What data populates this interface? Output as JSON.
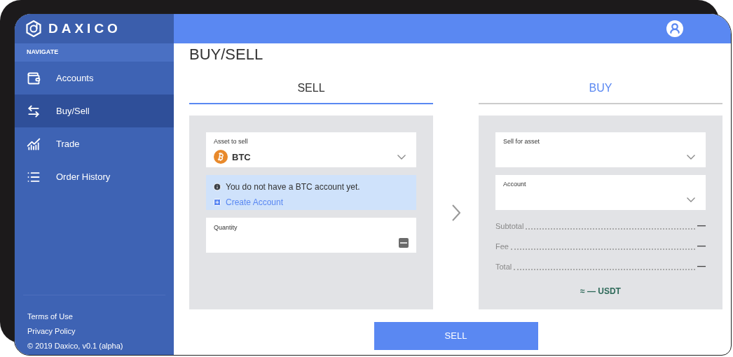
{
  "brand": "DAXICO",
  "sidebar": {
    "section": "NAVIGATE",
    "items": [
      {
        "label": "Accounts",
        "selected": false
      },
      {
        "label": "Buy/Sell",
        "selected": true
      },
      {
        "label": "Trade",
        "selected": false
      },
      {
        "label": "Order History",
        "selected": false
      }
    ],
    "footer": [
      "Terms of Use",
      "Privacy Policy",
      "© 2019 Daxico, v0.1 (alpha)"
    ]
  },
  "page_title": "BUY/SELL",
  "tabs": [
    {
      "label": "SELL",
      "selected": true
    },
    {
      "label": "BUY",
      "selected": false
    }
  ],
  "sell_panel": {
    "asset_field": {
      "label": "Asset to sell",
      "value": "BTC"
    },
    "notice": {
      "message": "You do not have a BTC account yet.",
      "link": "Create Account"
    },
    "quantity_field": {
      "label": "Quantity"
    }
  },
  "buy_panel": {
    "fields": [
      {
        "label": "Sell for asset"
      },
      {
        "label": "Account"
      }
    ],
    "summary": [
      {
        "label": "Subtotal",
        "value": "—"
      },
      {
        "label": "Fee",
        "value": "—"
      },
      {
        "label": "Total",
        "value": "—"
      }
    ],
    "conversion": "≈ — USDT"
  },
  "submit": "SELL"
}
